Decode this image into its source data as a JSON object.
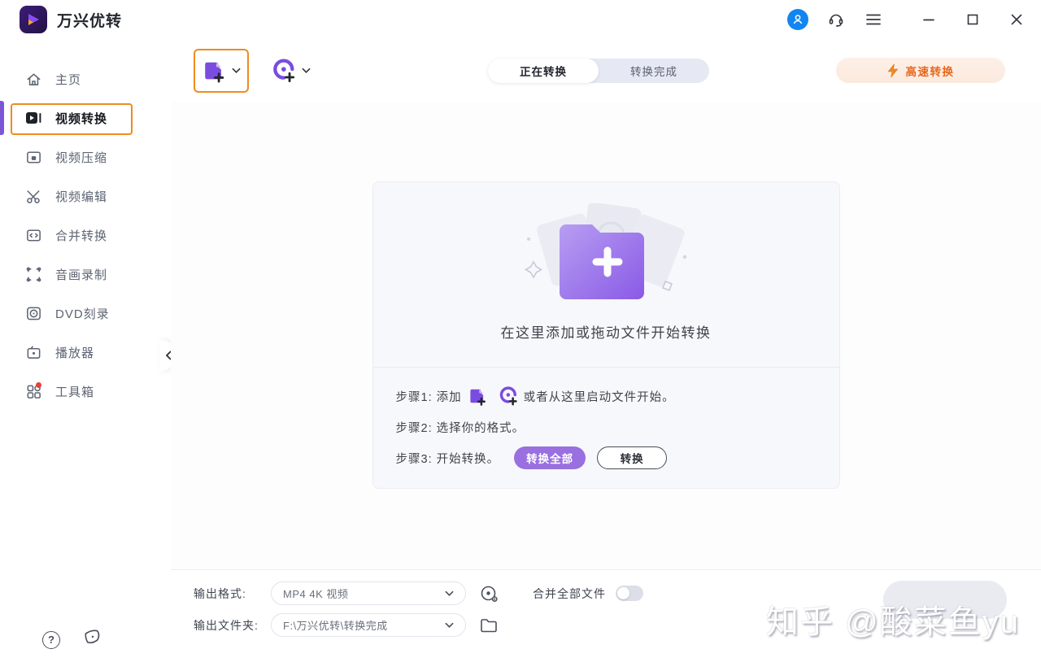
{
  "app": {
    "title": "万兴优转"
  },
  "titlebar": {
    "icons": [
      "user-avatar-icon",
      "headset-support-icon",
      "hamburger-menu-icon",
      "minimize-icon",
      "maximize-icon",
      "close-icon"
    ]
  },
  "sidebar": {
    "items": [
      {
        "label": "主页",
        "icon": "home-icon",
        "active": false
      },
      {
        "label": "视频转换",
        "icon": "video-convert-icon",
        "active": true
      },
      {
        "label": "视频压缩",
        "icon": "video-compress-icon",
        "active": false
      },
      {
        "label": "视频编辑",
        "icon": "scissors-icon",
        "active": false
      },
      {
        "label": "合并转换",
        "icon": "merge-convert-icon",
        "active": false
      },
      {
        "label": "音画录制",
        "icon": "screen-record-icon",
        "active": false
      },
      {
        "label": "DVD刻录",
        "icon": "dvd-burn-icon",
        "active": false
      },
      {
        "label": "播放器",
        "icon": "player-icon",
        "active": false
      },
      {
        "label": "工具箱",
        "icon": "toolbox-icon",
        "active": false,
        "badge": true
      }
    ],
    "footer_icons": [
      "help-icon",
      "feedback-icon"
    ],
    "collapse_icon": "chevron-left-icon"
  },
  "toolbar": {
    "add_buttons": [
      {
        "icon": "add-file-icon",
        "highlighted": true
      },
      {
        "icon": "add-disc-icon",
        "highlighted": false
      }
    ],
    "tabs": [
      {
        "label": "正在转换",
        "active": true
      },
      {
        "label": "转换完成",
        "active": false
      }
    ],
    "fast_convert_label": "高速转换",
    "fast_convert_icon": "lightning-icon"
  },
  "dropzone": {
    "hint": "在这里添加或拖动文件开始转换",
    "icon": "folder-plus-illustration"
  },
  "steps": {
    "step1_prefix": "步骤1: 添加",
    "step1_icons": [
      "add-file-icon",
      "add-disc-icon"
    ],
    "step1_suffix": "或者从这里启动文件开始。",
    "step2": "步骤2: 选择你的格式。",
    "step3": "步骤3: 开始转换。",
    "convert_all_label": "转换全部",
    "convert_label": "转换"
  },
  "output": {
    "format_label": "输出格式:",
    "format_value": "MP4 4K 视频",
    "format_settings_icon": "format-settings-icon",
    "merge_label": "合并全部文件",
    "merge_toggle_on": false,
    "folder_label": "输出文件夹:",
    "folder_value": "F:\\万兴优转\\转换完成",
    "folder_icon": "folder-icon"
  },
  "watermark": "知乎 @酸菜鱼yu",
  "colors": {
    "accent_purple": "#7b4fe0",
    "highlight_orange": "#ef8b1f",
    "fast_convert_orange": "#e8671b",
    "badge_red": "#e8403a",
    "avatar_blue": "#1285f0",
    "panel_bg": "#f7f8fb",
    "tab_track": "#e6e9f4"
  }
}
